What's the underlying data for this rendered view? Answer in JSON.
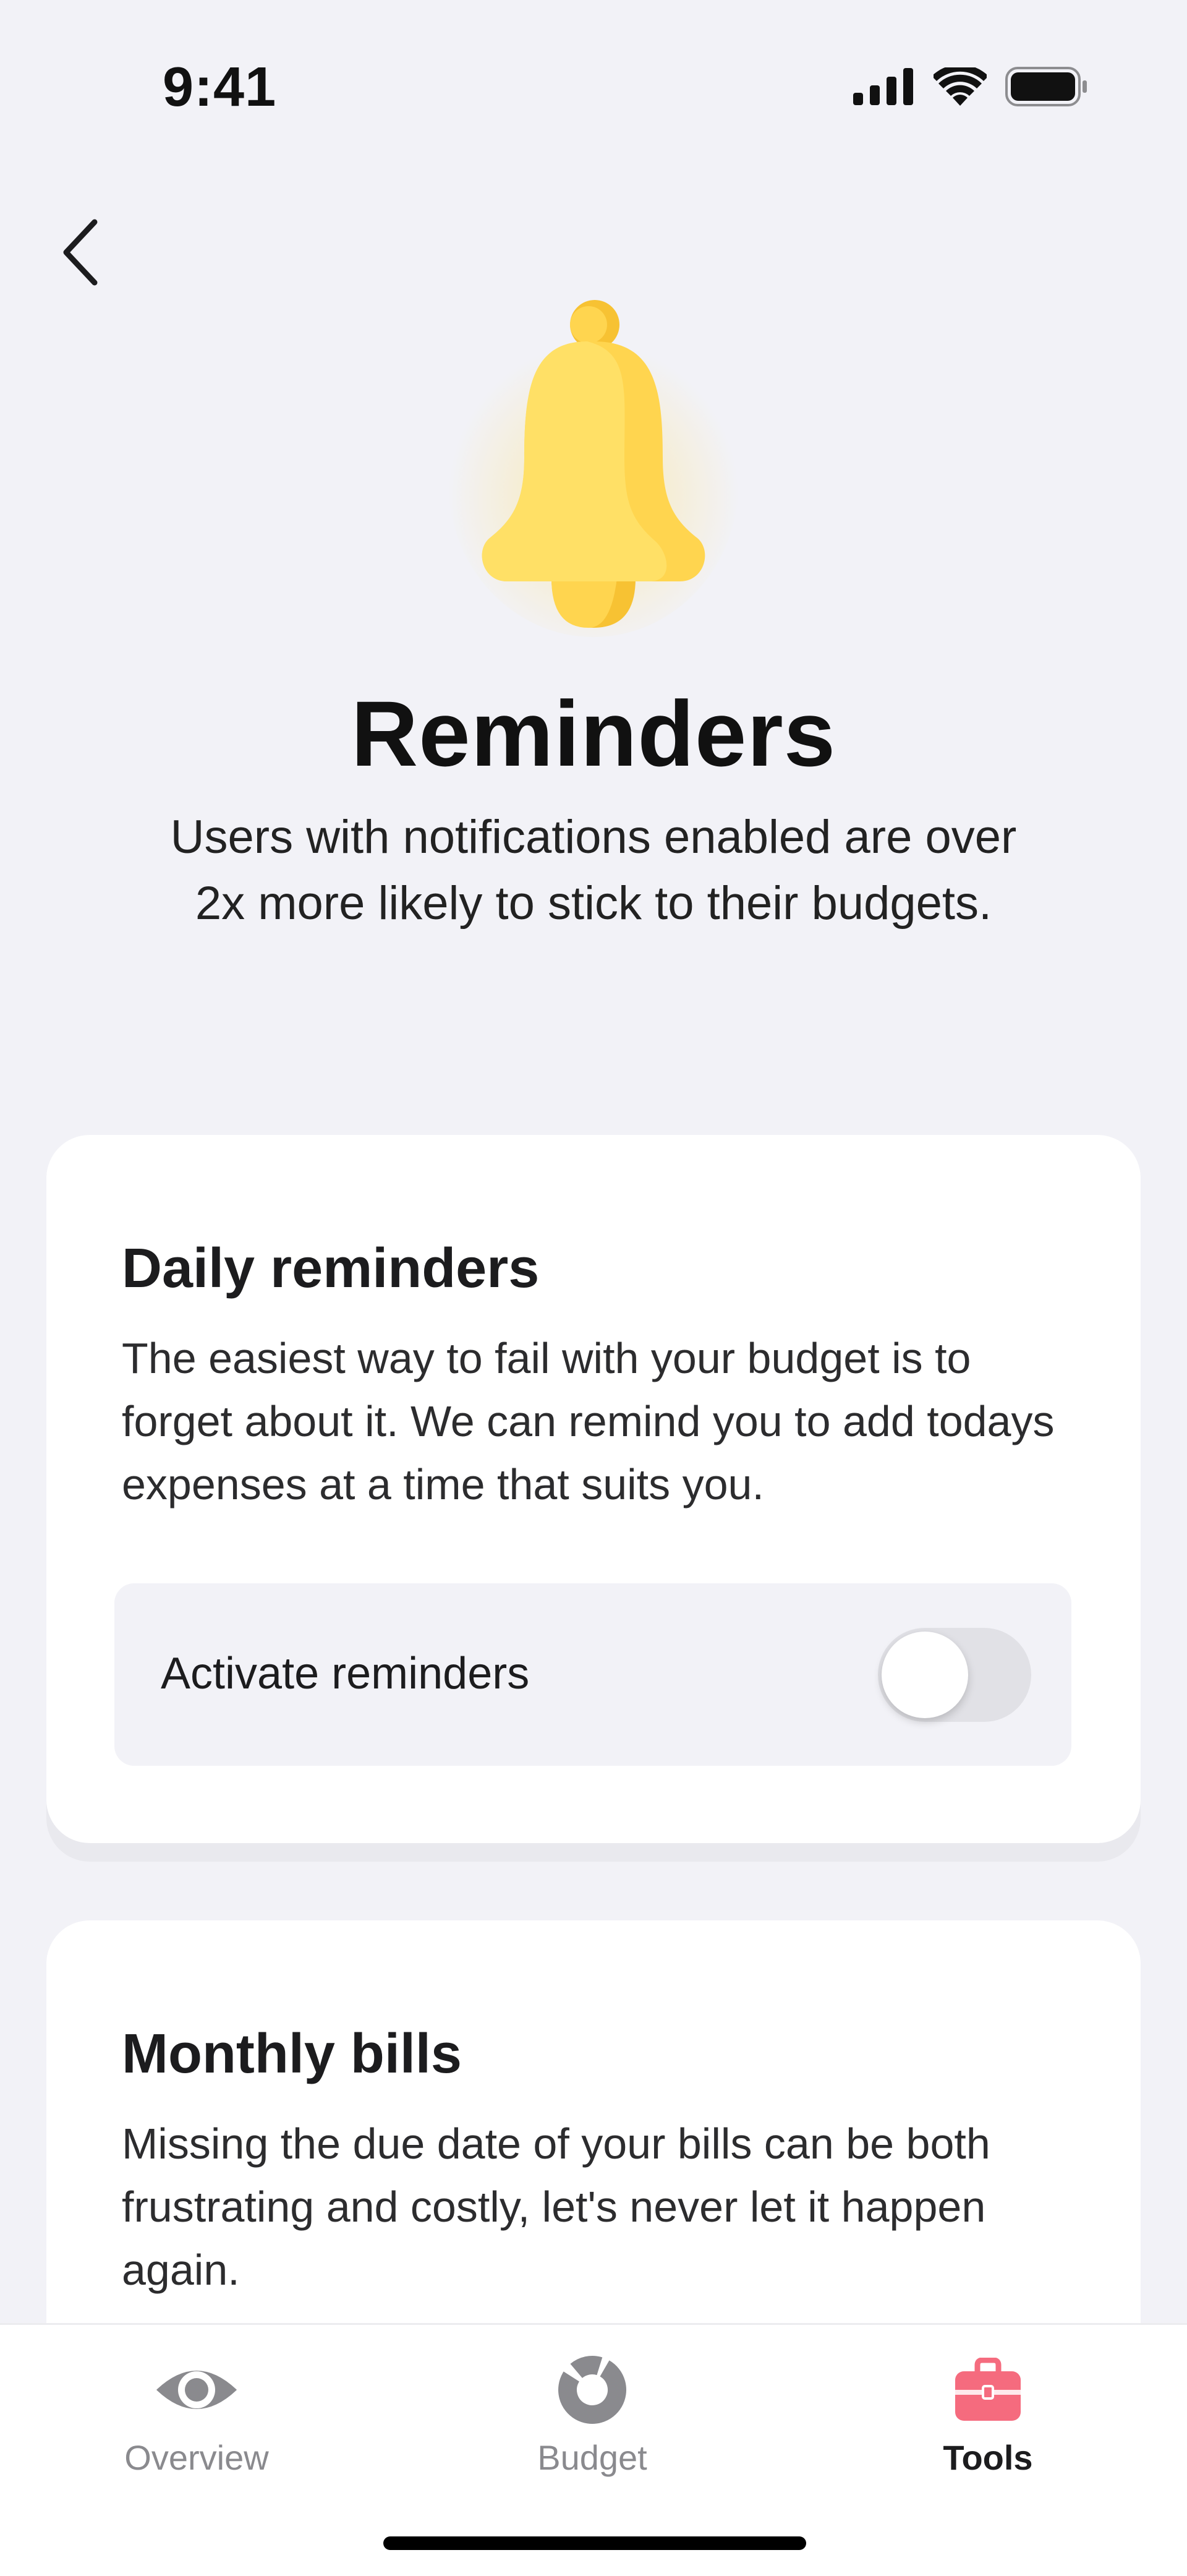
{
  "status_bar": {
    "time": "9:41",
    "icons": [
      "cellular-signal-icon",
      "wifi-icon",
      "battery-icon"
    ]
  },
  "header": {
    "back_icon": "chevron-left-icon",
    "hero_icon": "bell-icon",
    "title": "Reminders",
    "subtitle": "Users with notifications enabled are over 2x more likely to stick to their budgets."
  },
  "cards": {
    "daily": {
      "title": "Daily reminders",
      "description": "The easiest way to fail with your budget is to forget about it. We can remind you to add todays expenses at a time that suits you.",
      "toggle_label": "Activate reminders",
      "toggle_on": false
    },
    "bills": {
      "title": "Monthly bills",
      "description": "Missing the due date of your bills can be both frustrating and costly, let's never let it happen again."
    }
  },
  "tab_bar": {
    "tabs": [
      {
        "label": "Overview",
        "icon": "eye-icon",
        "active": false
      },
      {
        "label": "Budget",
        "icon": "donut-chart-icon",
        "active": false
      },
      {
        "label": "Tools",
        "icon": "toolbox-icon",
        "active": true
      }
    ]
  },
  "colors": {
    "background": "#F2F2F7",
    "card": "#FFFFFF",
    "bell_yellow": "#FFE066",
    "bell_shade": "#FFD54F",
    "bell_dark": "#F7C233",
    "tools_active": "#F56B7E",
    "tab_inactive": "#8A8A8E"
  }
}
